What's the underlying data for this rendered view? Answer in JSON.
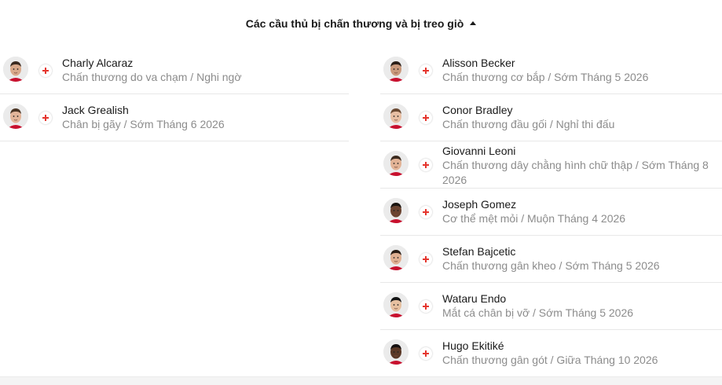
{
  "section": {
    "title": "Các cầu thủ bị chấn thương và bị treo giò",
    "caret_icon": "caret-up-icon"
  },
  "colors": {
    "injury_cross": "#e5362e",
    "status_text": "#8c8c8c",
    "name_text": "#1a1a1a"
  },
  "left_column": [
    {
      "name": "Charly Alcaraz",
      "status": "Chấn thương do va chạm / Nghi ngờ",
      "skin": "#d9a98b",
      "hair": "#3a2a20"
    },
    {
      "name": "Jack Grealish",
      "status": "Chân bị gãy / Sớm Tháng 6 2026",
      "skin": "#e3b59a",
      "hair": "#4a3424"
    }
  ],
  "right_column": [
    {
      "name": "Alisson Becker",
      "status": "Chấn thương cơ bắp / Sớm Tháng 5 2026",
      "skin": "#c9997c",
      "hair": "#2a1f18"
    },
    {
      "name": "Conor Bradley",
      "status": "Chấn thương đầu gối / Nghỉ thi đấu",
      "skin": "#e8bfa4",
      "hair": "#6b4a33"
    },
    {
      "name": "Giovanni Leoni",
      "status": "Chấn thương dây chằng hình chữ thập / Sớm Tháng 8 2026",
      "skin": "#e2b396",
      "hair": "#3b2a1e"
    },
    {
      "name": "Joseph Gomez",
      "status": "Cơ thể mệt mỏi / Muộn Tháng 4 2026",
      "skin": "#6a4330",
      "hair": "#1a1410"
    },
    {
      "name": "Stefan Bajcetic",
      "status": "Chấn thương gân kheo / Sớm Tháng 5 2026",
      "skin": "#e0b092",
      "hair": "#2a1d15"
    },
    {
      "name": "Wataru Endo",
      "status": "Mắt cá chân bị vỡ / Sớm Tháng 5 2026",
      "skin": "#e6c0a0",
      "hair": "#141414"
    },
    {
      "name": "Hugo Ekitiké",
      "status": "Chấn thương gân gót / Giữa Tháng 10 2026",
      "skin": "#5a3826",
      "hair": "#151010"
    }
  ]
}
